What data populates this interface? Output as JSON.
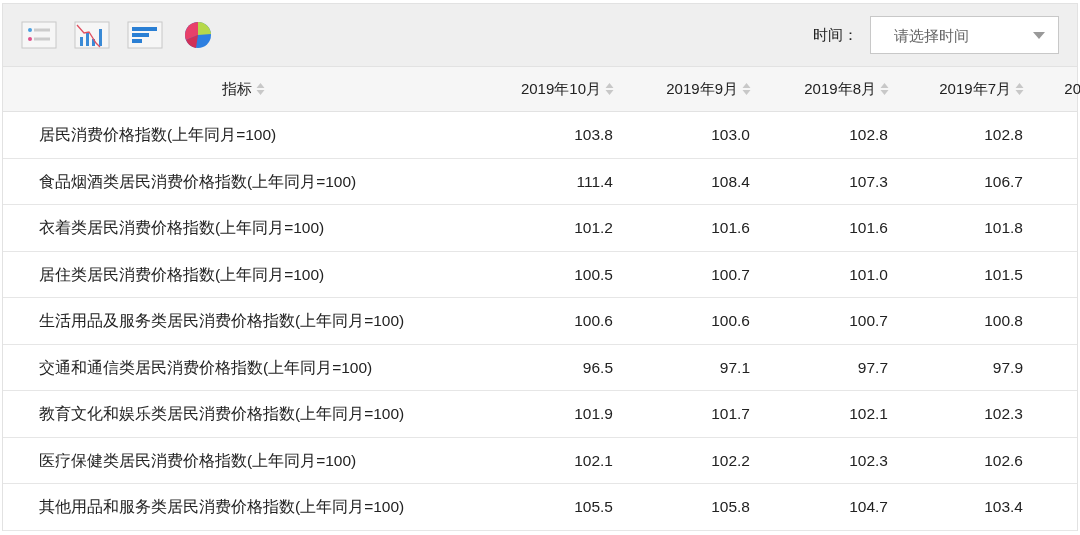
{
  "toolbar": {
    "time_label": "时间：",
    "time_select": {
      "placeholder": "请选择时间"
    }
  },
  "table": {
    "columns": [
      {
        "label": "指标",
        "sortable": true
      },
      {
        "label": "2019年10月",
        "sortable": true
      },
      {
        "label": "2019年9月",
        "sortable": true
      },
      {
        "label": "2019年8月",
        "sortable": true
      },
      {
        "label": "2019年7月",
        "sortable": true
      },
      {
        "label": "20",
        "sortable": false
      }
    ],
    "rows": [
      {
        "indicator": "居民消费价格指数(上年同月=100)",
        "values": [
          "103.8",
          "103.0",
          "102.8",
          "102.8"
        ]
      },
      {
        "indicator": "食品烟酒类居民消费价格指数(上年同月=100)",
        "values": [
          "111.4",
          "108.4",
          "107.3",
          "106.7"
        ]
      },
      {
        "indicator": "衣着类居民消费价格指数(上年同月=100)",
        "values": [
          "101.2",
          "101.6",
          "101.6",
          "101.8"
        ]
      },
      {
        "indicator": "居住类居民消费价格指数(上年同月=100)",
        "values": [
          "100.5",
          "100.7",
          "101.0",
          "101.5"
        ]
      },
      {
        "indicator": "生活用品及服务类居民消费价格指数(上年同月=100)",
        "values": [
          "100.6",
          "100.6",
          "100.7",
          "100.8"
        ]
      },
      {
        "indicator": "交通和通信类居民消费价格指数(上年同月=100)",
        "values": [
          "96.5",
          "97.1",
          "97.7",
          "97.9"
        ]
      },
      {
        "indicator": "教育文化和娱乐类居民消费价格指数(上年同月=100)",
        "values": [
          "101.9",
          "101.7",
          "102.1",
          "102.3"
        ]
      },
      {
        "indicator": "医疗保健类居民消费价格指数(上年同月=100)",
        "values": [
          "102.1",
          "102.2",
          "102.3",
          "102.6"
        ]
      },
      {
        "indicator": "其他用品和服务类居民消费价格指数(上年同月=100)",
        "values": [
          "105.5",
          "105.8",
          "104.7",
          "103.4"
        ]
      }
    ]
  }
}
